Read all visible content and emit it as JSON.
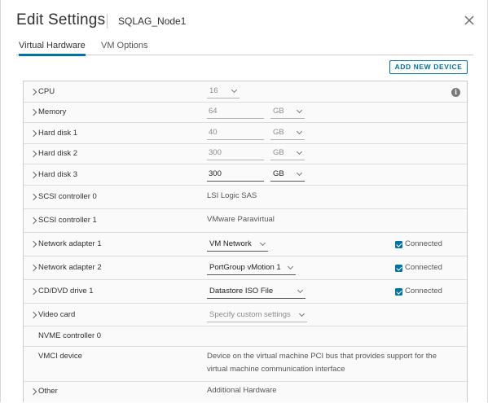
{
  "dialog": {
    "title": "Edit Settings",
    "subtitle": "SQLAG_Node1",
    "close_icon": "close-icon"
  },
  "tabs": [
    {
      "label": "Virtual Hardware",
      "active": true
    },
    {
      "label": "VM Options",
      "active": false
    }
  ],
  "toolbar": {
    "add_device_label": "ADD NEW DEVICE"
  },
  "hardware": {
    "cpu": {
      "label": "CPU",
      "value": "16"
    },
    "memory": {
      "label": "Memory",
      "value": "64",
      "unit": "GB"
    },
    "disk1": {
      "label": "Hard disk 1",
      "value": "40",
      "unit": "GB"
    },
    "disk2": {
      "label": "Hard disk 2",
      "value": "300",
      "unit": "GB"
    },
    "disk3": {
      "label": "Hard disk 3",
      "value": "300",
      "unit": "GB"
    },
    "scsi0": {
      "label": "SCSI controller 0",
      "value": "LSI Logic SAS"
    },
    "scsi1": {
      "label": "SCSI controller 1",
      "value": "VMware Paravirtual"
    },
    "net1": {
      "label": "Network adapter 1",
      "value": "VM Network",
      "connected_label": "Connected",
      "connected": true
    },
    "net2": {
      "label": "Network adapter 2",
      "value": "PortGroup vMotion 1",
      "connected_label": "Connected",
      "connected": true
    },
    "cd": {
      "label": "CD/DVD drive 1",
      "value": "Datastore ISO File",
      "connected_label": "Connected",
      "connected": true
    },
    "video": {
      "label": "Video card",
      "value": "Specify custom settings"
    },
    "nvme": {
      "label": "NVME controller 0"
    },
    "vmci": {
      "label": "VMCI device",
      "value_line1": "Device on the virtual machine PCI bus that provides support for the",
      "value_line2": "virtual machine communication interface"
    },
    "other": {
      "label": "Other",
      "value": "Additional Hardware"
    }
  },
  "colors": {
    "accent": "#0072a3",
    "border": "#cccccc",
    "row_bg": "#fafafa"
  }
}
